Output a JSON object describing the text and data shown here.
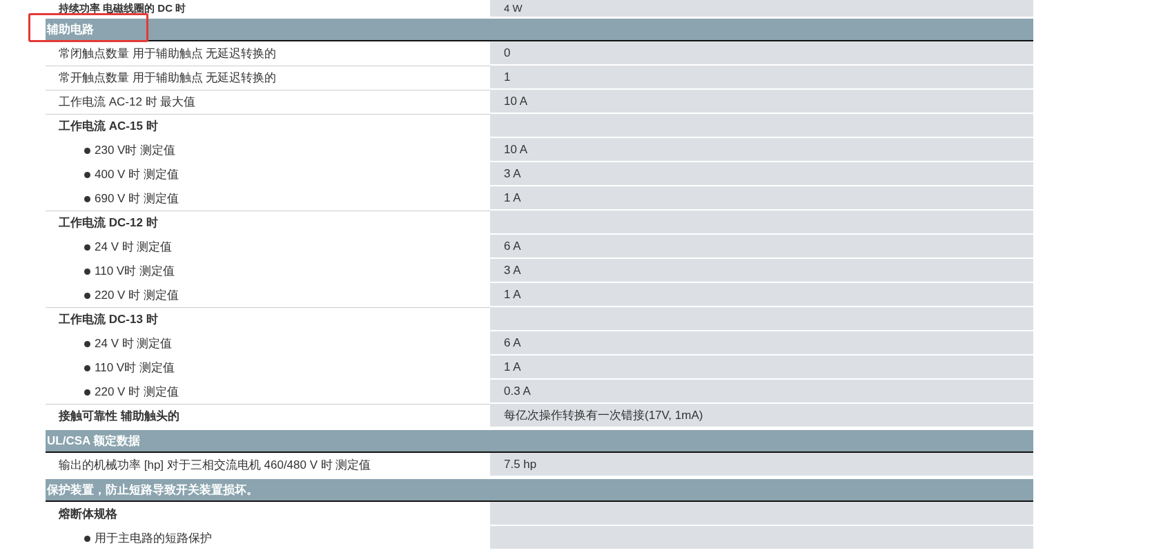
{
  "top_row": {
    "label": "持续功率 电磁线圈的 DC 时",
    "value": "4 W"
  },
  "sections": [
    {
      "title": "辅助电路",
      "highlighted": true,
      "rows": [
        {
          "kind": "row",
          "label": "常闭触点数量 用于辅助触点 无延迟转换的",
          "value": "0"
        },
        {
          "kind": "row",
          "label": "常开触点数量 用于辅助触点 无延迟转换的",
          "value": "1"
        },
        {
          "kind": "row",
          "label": "工作电流 AC-12 时 最大值",
          "value": "10 A"
        },
        {
          "kind": "group",
          "label": "工作电流 AC-15 时"
        },
        {
          "kind": "item",
          "label": "230 V时 测定值",
          "value": "10 A"
        },
        {
          "kind": "item",
          "label": "400 V 时 测定值",
          "value": "3 A"
        },
        {
          "kind": "item",
          "label": "690 V 时 测定值",
          "value": "1 A"
        },
        {
          "kind": "group",
          "label": "工作电流 DC-12 时"
        },
        {
          "kind": "item",
          "label": "24 V 时 测定值",
          "value": "6 A"
        },
        {
          "kind": "item",
          "label": "110 V时 测定值",
          "value": "3 A"
        },
        {
          "kind": "item",
          "label": "220 V 时 测定值",
          "value": "1 A"
        },
        {
          "kind": "group",
          "label": "工作电流 DC-13 时"
        },
        {
          "kind": "item",
          "label": "24 V 时 测定值",
          "value": "6 A"
        },
        {
          "kind": "item",
          "label": "110 V时 测定值",
          "value": "1 A"
        },
        {
          "kind": "item",
          "label": "220 V 时 测定值",
          "value": "0.3 A"
        },
        {
          "kind": "group",
          "label": "接触可靠性 辅助触头的",
          "value": "每亿次操作转换有一次错接(17V, 1mA)"
        }
      ]
    },
    {
      "title": "UL/CSA 额定数据",
      "highlighted": false,
      "rows": [
        {
          "kind": "row",
          "label": "输出的机械功率 [hp] 对于三相交流电机 460/480 V 时 测定值",
          "value": "7.5 hp"
        }
      ]
    },
    {
      "title": "保护装置，防止短路导致开关装置损坏。",
      "highlighted": false,
      "rows": [
        {
          "kind": "group",
          "label": "熔断体规格"
        },
        {
          "kind": "item",
          "label": "用于主电路的短路保护"
        }
      ]
    }
  ]
}
